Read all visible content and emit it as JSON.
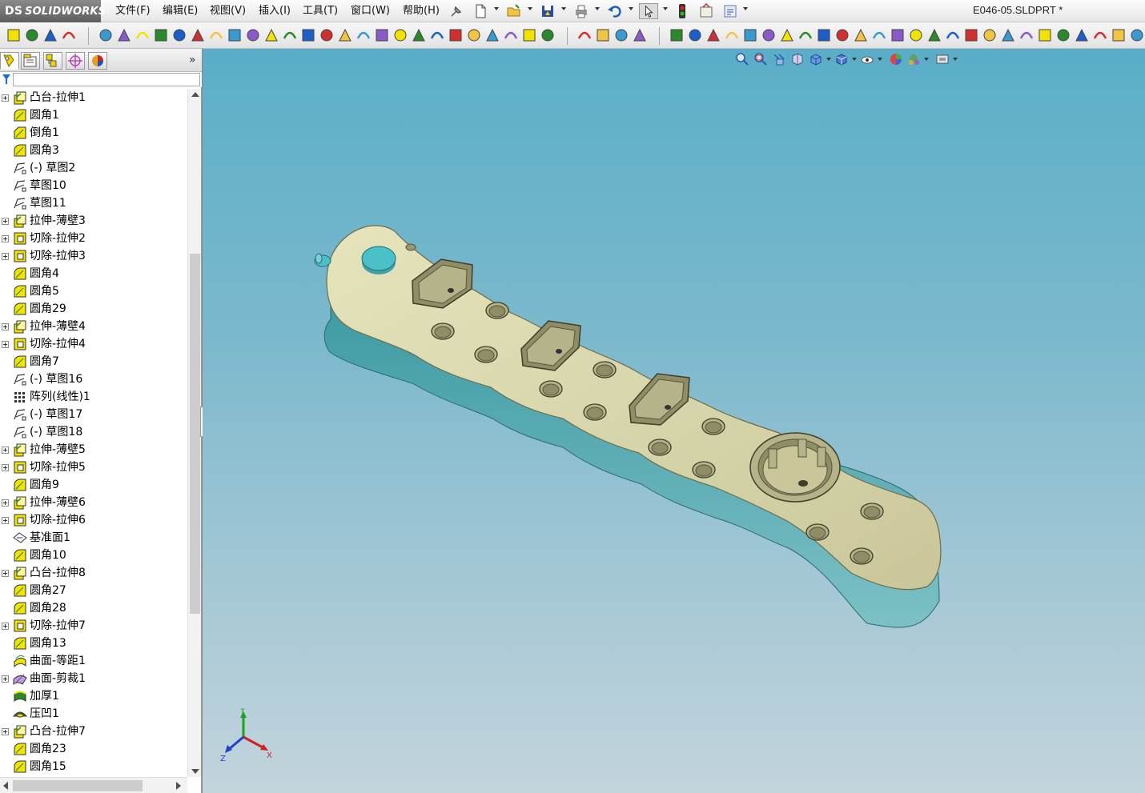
{
  "app": {
    "logo_text": "SOLIDWORKS",
    "logo_mark": "DS",
    "document_title": "E046-05.SLDPRT *"
  },
  "menu": {
    "file": "文件(F)",
    "edit": "编辑(E)",
    "view": "视图(V)",
    "insert": "插入(I)",
    "tools": "工具(T)",
    "window": "窗口(W)",
    "help": "帮助(H)"
  },
  "panel": {
    "expand_glyph": "»",
    "tabs": [
      "feature-manager-icon",
      "property-manager-icon",
      "configuration-manager-icon",
      "dimxpert-icon",
      "display-manager-icon"
    ]
  },
  "feature_tree": {
    "items": [
      {
        "label": "凸台-拉伸1",
        "icon": "extrude-boss-icon",
        "expandable": true
      },
      {
        "label": "圆角1",
        "icon": "fillet-icon",
        "expandable": false
      },
      {
        "label": "倒角1",
        "icon": "chamfer-icon",
        "expandable": false
      },
      {
        "label": "圆角3",
        "icon": "fillet-icon",
        "expandable": false
      },
      {
        "label": "(-) 草图2",
        "icon": "sketch-icon",
        "expandable": false
      },
      {
        "label": "草图10",
        "icon": "sketch-icon",
        "expandable": false
      },
      {
        "label": "草图11",
        "icon": "sketch-icon",
        "expandable": false
      },
      {
        "label": "拉伸-薄壁3",
        "icon": "extrude-boss-icon",
        "expandable": true
      },
      {
        "label": "切除-拉伸2",
        "icon": "extrude-cut-icon",
        "expandable": true
      },
      {
        "label": "切除-拉伸3",
        "icon": "extrude-cut-icon",
        "expandable": true
      },
      {
        "label": "圆角4",
        "icon": "fillet-icon",
        "expandable": false
      },
      {
        "label": "圆角5",
        "icon": "fillet-icon",
        "expandable": false
      },
      {
        "label": "圆角29",
        "icon": "fillet-icon",
        "expandable": false
      },
      {
        "label": "拉伸-薄壁4",
        "icon": "extrude-boss-icon",
        "expandable": true
      },
      {
        "label": "切除-拉伸4",
        "icon": "extrude-cut-icon",
        "expandable": true
      },
      {
        "label": "圆角7",
        "icon": "fillet-icon",
        "expandable": false
      },
      {
        "label": "(-) 草图16",
        "icon": "sketch-icon",
        "expandable": false
      },
      {
        "label": "阵列(线性)1",
        "icon": "linear-pattern-icon",
        "expandable": false
      },
      {
        "label": "(-) 草图17",
        "icon": "sketch-icon",
        "expandable": false
      },
      {
        "label": "(-) 草图18",
        "icon": "sketch-icon",
        "expandable": false
      },
      {
        "label": "拉伸-薄壁5",
        "icon": "extrude-boss-icon",
        "expandable": true
      },
      {
        "label": "切除-拉伸5",
        "icon": "extrude-cut-icon",
        "expandable": true
      },
      {
        "label": "圆角9",
        "icon": "fillet-icon",
        "expandable": false
      },
      {
        "label": "拉伸-薄壁6",
        "icon": "extrude-boss-icon",
        "expandable": true
      },
      {
        "label": "切除-拉伸6",
        "icon": "extrude-cut-icon",
        "expandable": true
      },
      {
        "label": "基准面1",
        "icon": "plane-icon",
        "expandable": false
      },
      {
        "label": "圆角10",
        "icon": "fillet-icon",
        "expandable": false
      },
      {
        "label": "凸台-拉伸8",
        "icon": "extrude-boss-icon",
        "expandable": true
      },
      {
        "label": "圆角27",
        "icon": "fillet-icon",
        "expandable": false
      },
      {
        "label": "圆角28",
        "icon": "fillet-icon",
        "expandable": false
      },
      {
        "label": "切除-拉伸7",
        "icon": "extrude-cut-icon",
        "expandable": true
      },
      {
        "label": "圆角13",
        "icon": "fillet-icon",
        "expandable": false
      },
      {
        "label": "曲面-等距1",
        "icon": "offset-surface-icon",
        "expandable": false
      },
      {
        "label": "曲面-剪裁1",
        "icon": "trim-surface-icon",
        "expandable": true
      },
      {
        "label": "加厚1",
        "icon": "thicken-icon",
        "expandable": false
      },
      {
        "label": "压凹1",
        "icon": "indent-icon",
        "expandable": false
      },
      {
        "label": "凸台-拉伸7",
        "icon": "extrude-boss-icon",
        "expandable": true
      },
      {
        "label": "圆角23",
        "icon": "fillet-icon",
        "expandable": false
      },
      {
        "label": "圆角15",
        "icon": "fillet-icon",
        "expandable": false
      }
    ]
  },
  "triad": {
    "x": "X",
    "y": "Y",
    "z": "Z"
  },
  "colors": {
    "viewport_top": "#5aaec8",
    "viewport_bottom": "#c3d4dc",
    "part_top": "#d8d6ac",
    "part_side": "#5aa8b0",
    "button": "#4cc0c8",
    "feature_icon": "#f2e400"
  }
}
